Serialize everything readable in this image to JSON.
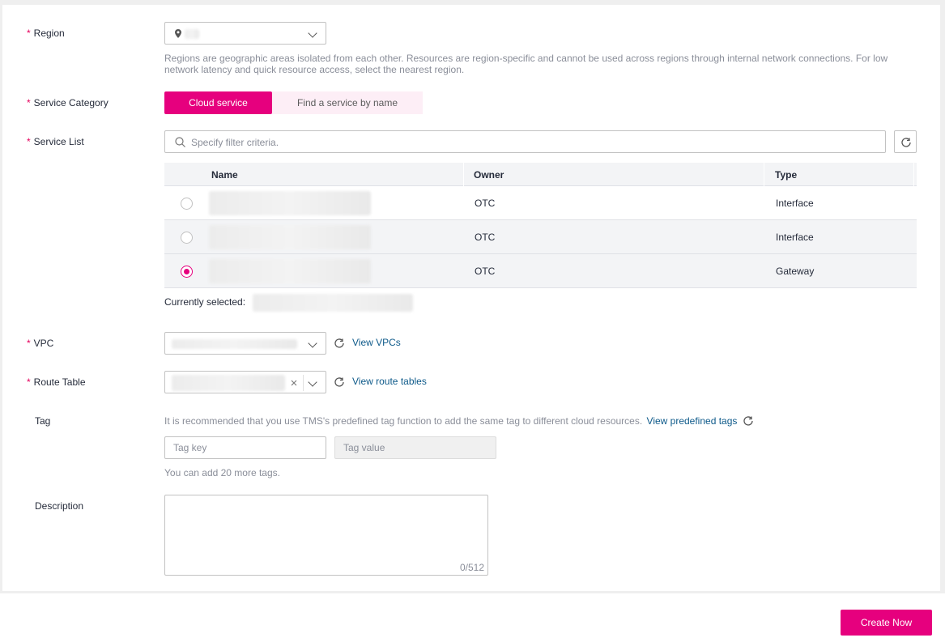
{
  "region": {
    "label": "Region",
    "value": "",
    "hint": "Regions are geographic areas isolated from each other. Resources are region-specific and cannot be used across regions through internal network connections. For low network latency and quick resource access, select the nearest region."
  },
  "service_category": {
    "label": "Service Category",
    "tabs": [
      {
        "label": "Cloud service",
        "active": true
      },
      {
        "label": "Find a service by name",
        "active": false
      }
    ]
  },
  "service_list": {
    "label": "Service List",
    "search_placeholder": "Specify filter criteria.",
    "columns": [
      "Name",
      "Owner",
      "Type"
    ],
    "rows": [
      {
        "name": "",
        "owner": "OTC",
        "type": "Interface",
        "selected": false
      },
      {
        "name": "",
        "owner": "OTC",
        "type": "Interface",
        "selected": false
      },
      {
        "name": "",
        "owner": "OTC",
        "type": "Gateway",
        "selected": true
      }
    ],
    "currently_selected_label": "Currently selected:"
  },
  "vpc": {
    "label": "VPC",
    "link": "View VPCs"
  },
  "route_table": {
    "label": "Route Table",
    "link": "View route tables"
  },
  "tag": {
    "label": "Tag",
    "hint": "It is recommended that you use TMS's predefined tag function to add the same tag to different cloud resources.",
    "link": "View predefined tags",
    "key_placeholder": "Tag key",
    "value_placeholder": "Tag value",
    "remaining": "You can add 20 more tags."
  },
  "description": {
    "label": "Description",
    "counter": "0/512"
  },
  "footer": {
    "create_label": "Create Now"
  },
  "colors": {
    "accent": "#e6007e",
    "required": "#e6005c",
    "link": "#0e5a8a"
  }
}
